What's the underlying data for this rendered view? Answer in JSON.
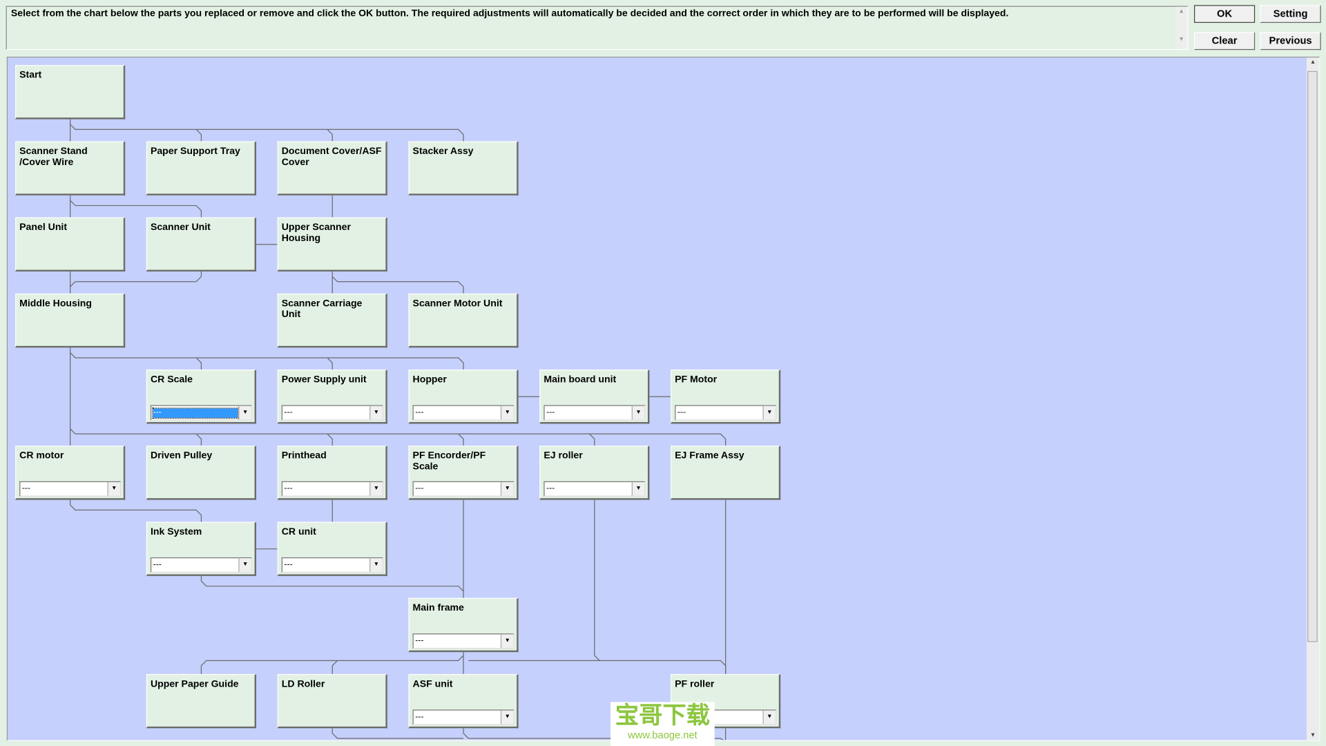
{
  "instructions": "Select from the chart below the parts you replaced or remove and click the OK button. The required adjustments will automatically be decided and the correct order in which they are to be performed will be displayed.",
  "buttons": {
    "ok": "OK",
    "setting": "Setting",
    "clear": "Clear",
    "previous": "Previous"
  },
  "colors": {
    "panel_bg": "#c5d0fc",
    "box_bg": "#e2f1e3",
    "selected": "#3399ff"
  },
  "parts": [
    {
      "label": "Start",
      "col": 0,
      "row": 0
    },
    {
      "label": "Scanner Stand /Cover Wire",
      "col": 0,
      "row": 1
    },
    {
      "label": "Paper Support Tray",
      "col": 1,
      "row": 1
    },
    {
      "label": "Document Cover/ASF Cover",
      "col": 2,
      "row": 1
    },
    {
      "label": "Stacker Assy",
      "col": 3,
      "row": 1
    },
    {
      "label": "Panel Unit",
      "col": 0,
      "row": 2
    },
    {
      "label": "Scanner Unit",
      "col": 1,
      "row": 2
    },
    {
      "label": "Upper Scanner Housing",
      "col": 2,
      "row": 2
    },
    {
      "label": "Middle Housing",
      "col": 0,
      "row": 3
    },
    {
      "label": "Scanner Carriage Unit",
      "col": 2,
      "row": 3
    },
    {
      "label": "Scanner Motor Unit",
      "col": 3,
      "row": 3
    },
    {
      "label": "CR Scale",
      "col": 1,
      "row": 4,
      "dropdown": "---",
      "selected": true
    },
    {
      "label": "Power Supply unit",
      "col": 2,
      "row": 4,
      "dropdown": "---"
    },
    {
      "label": "Hopper",
      "col": 3,
      "row": 4,
      "dropdown": "---"
    },
    {
      "label": "Main board unit",
      "col": 4,
      "row": 4,
      "dropdown": "---"
    },
    {
      "label": "PF Motor",
      "col": 5,
      "row": 4,
      "dropdown": "---"
    },
    {
      "label": "CR motor",
      "col": 0,
      "row": 5,
      "dropdown": "---"
    },
    {
      "label": "Driven Pulley",
      "col": 1,
      "row": 5
    },
    {
      "label": "Printhead",
      "col": 2,
      "row": 5,
      "dropdown": "---"
    },
    {
      "label": "PF Encorder/PF Scale",
      "col": 3,
      "row": 5,
      "dropdown": "---"
    },
    {
      "label": "EJ roller",
      "col": 4,
      "row": 5,
      "dropdown": "---"
    },
    {
      "label": "EJ Frame Assy",
      "col": 5,
      "row": 5
    },
    {
      "label": "Ink System",
      "col": 1,
      "row": 6,
      "dropdown": "---"
    },
    {
      "label": "CR unit",
      "col": 2,
      "row": 6,
      "dropdown": "---"
    },
    {
      "label": "Main frame",
      "col": 3,
      "row": 7,
      "dropdown": "---"
    },
    {
      "label": "Upper Paper Guide",
      "col": 1,
      "row": 8
    },
    {
      "label": "LD Roller",
      "col": 2,
      "row": 8
    },
    {
      "label": "ASF unit",
      "col": 3,
      "row": 8,
      "dropdown": "---"
    },
    {
      "label": "PF roller",
      "col": 5,
      "row": 8,
      "dropdown": "---"
    }
  ],
  "watermark": {
    "text": "宝哥下载",
    "url": "www.baoge.net"
  }
}
